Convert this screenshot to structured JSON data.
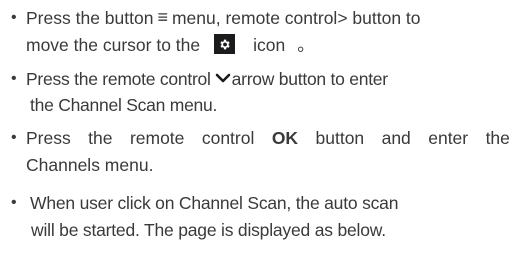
{
  "instructions": [
    {
      "line1_a": "Press the button",
      "menu_glyph": "≡",
      "line1_b": "menu, remote control> button to",
      "line2_a": "move the cursor to the",
      "icon": "settings-gear-icon",
      "line2_b": "icon",
      "line2_end": "。"
    },
    {
      "line1_a": "Press the remote control",
      "arrow_icon": "chevron-down-icon",
      "line1_b": "arrow button to enter",
      "line2": "the Channel Scan menu."
    },
    {
      "line1_words": [
        "Press",
        "the",
        "remote",
        "control",
        "OK",
        "button",
        "and",
        "enter",
        "the"
      ],
      "line2": "Channels menu."
    },
    {
      "line1": "When user click on Channel Scan, the auto scan",
      "line2": "will be started. The  page is displayed as below."
    }
  ]
}
